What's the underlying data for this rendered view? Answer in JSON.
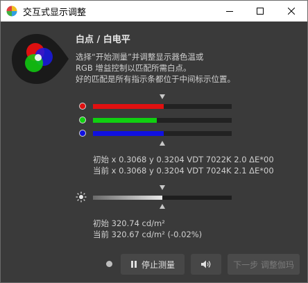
{
  "window": {
    "title": "交互式显示调整",
    "minimize_icon": "minimize-icon",
    "maximize_icon": "maximize-icon",
    "close_icon": "close-icon"
  },
  "header": {
    "title": "白点 / 白电平",
    "instructions": [
      "选择“开始测量”并调整显示器色温或",
      "RGB 增益控制以匹配所需白点。",
      "好的匹配是所有指示条都位于中间标示位置。"
    ]
  },
  "colors": {
    "red": "#e01010",
    "green": "#10d010",
    "blue": "#1010e0",
    "panel": "#3a3a3a",
    "track": "#222222"
  },
  "rgb_bars": [
    {
      "channel": "red",
      "level_percent": 51
    },
    {
      "channel": "green",
      "level_percent": 46
    },
    {
      "channel": "blue",
      "level_percent": 51
    }
  ],
  "readouts": {
    "initial": "初始 x 0.3068 y 0.3204 VDT 7022K 2.0 ΔE*00",
    "current": "当前 x 0.3068 y 0.3204 VDT 7024K 2.1 ΔE*00"
  },
  "luminance": {
    "icon": "brightness-icon",
    "level_percent": 50,
    "initial": "初始 320.74 cd/m²",
    "current": "当前 320.67 cd/m² (-0.02%)"
  },
  "footer": {
    "pause_button": "停止测量",
    "pause_icon": "pause-icon",
    "sound_icon": "speaker-icon",
    "next_button": "下一步 调整伽玛"
  }
}
